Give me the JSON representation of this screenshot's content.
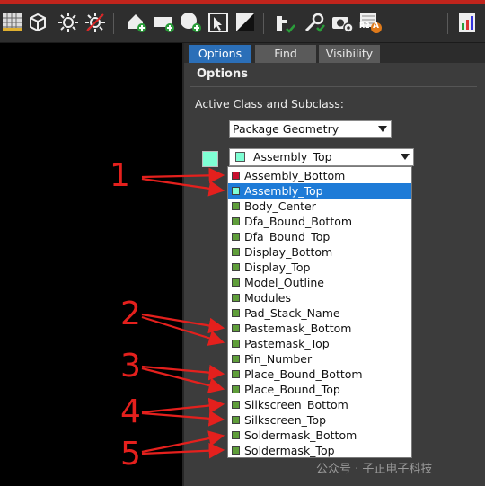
{
  "tabs": [
    {
      "label": "Options"
    },
    {
      "label": "Find"
    },
    {
      "label": "Visibility"
    }
  ],
  "options_panel": {
    "title": "Options",
    "active_class_label": "Active Class and Subclass:",
    "class_value": "Package Geometry",
    "subclass_value": "Assembly_Top",
    "subclass_color": "#7fffd4"
  },
  "subclass_list": [
    {
      "label": "Assembly_Bottom",
      "color": "#c8102e",
      "selected": false
    },
    {
      "label": "Assembly_Top",
      "color": "#7fffd4",
      "selected": true
    },
    {
      "label": "Body_Center",
      "color": "#5f9e3a",
      "selected": false
    },
    {
      "label": "Dfa_Bound_Bottom",
      "color": "#5f9e3a",
      "selected": false
    },
    {
      "label": "Dfa_Bound_Top",
      "color": "#5f9e3a",
      "selected": false
    },
    {
      "label": "Display_Bottom",
      "color": "#5f9e3a",
      "selected": false
    },
    {
      "label": "Display_Top",
      "color": "#5f9e3a",
      "selected": false
    },
    {
      "label": "Model_Outline",
      "color": "#5f9e3a",
      "selected": false
    },
    {
      "label": "Modules",
      "color": "#5f9e3a",
      "selected": false
    },
    {
      "label": "Pad_Stack_Name",
      "color": "#5f9e3a",
      "selected": false
    },
    {
      "label": "Pastemask_Bottom",
      "color": "#5f9e3a",
      "selected": false
    },
    {
      "label": "Pastemask_Top",
      "color": "#5f9e3a",
      "selected": false
    },
    {
      "label": "Pin_Number",
      "color": "#5f9e3a",
      "selected": false
    },
    {
      "label": "Place_Bound_Bottom",
      "color": "#5f9e3a",
      "selected": false
    },
    {
      "label": "Place_Bound_Top",
      "color": "#5f9e3a",
      "selected": false
    },
    {
      "label": "Silkscreen_Bottom",
      "color": "#5f9e3a",
      "selected": false
    },
    {
      "label": "Silkscreen_Top",
      "color": "#5f9e3a",
      "selected": false
    },
    {
      "label": "Soldermask_Bottom",
      "color": "#5f9e3a",
      "selected": false
    },
    {
      "label": "Soldermask_Top",
      "color": "#5f9e3a",
      "selected": false
    }
  ],
  "annotations": [
    {
      "number": "1"
    },
    {
      "number": "2"
    },
    {
      "number": "3"
    },
    {
      "number": "4"
    },
    {
      "number": "5"
    }
  ],
  "annotation_color": "#e4201d",
  "watermark": "公众号 · 子正电子科技",
  "toolbar": {
    "icons": [
      "grid-ruler-icon",
      "cube-icon",
      "palette-icon",
      "sun-icon",
      "sun-off-icon",
      "add-shape-icon",
      "add-rect-icon",
      "add-circle-icon",
      "select-arrow-icon",
      "split-shape-icon",
      "check-tool-icon",
      "wrench-tool-icon",
      "camera-gear-icon",
      "r2-report-icon",
      "chart-report-icon"
    ],
    "r2_label": "R2",
    "r2_badge": "A"
  }
}
